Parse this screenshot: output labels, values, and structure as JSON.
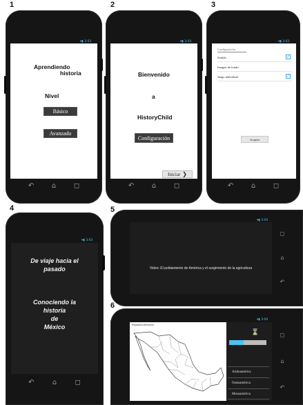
{
  "labels": [
    "1",
    "2",
    "3",
    "4",
    "5",
    "6"
  ],
  "status_time_a": "3:03",
  "status_time_b": "3:04",
  "nav_icons": [
    "back-icon",
    "home-icon",
    "recents-icon"
  ],
  "screen1": {
    "title_line1": "Aprendiendo",
    "title_line2": "historia",
    "level_label": "Nivel",
    "basic_button": "Básico",
    "advanced_button": "Avanzado"
  },
  "screen2": {
    "welcome": "Bienvenido",
    "to": "a",
    "app_name": "HistoryChild",
    "settings_button": "Configuración",
    "start_button": "Iniciar"
  },
  "screen3": {
    "header": "Configuración",
    "options": [
      {
        "label": "Sonido",
        "checked": true
      },
      {
        "label": "Imagen de fondo",
        "checked": false
      },
      {
        "label": "Juego individual",
        "checked": true
      }
    ],
    "accept_button": "Aceptar"
  },
  "screen4": {
    "line1": "De viaje hacia el",
    "line2": "pasado",
    "line3": "Conociendo la",
    "line4": "historia",
    "line5": "de",
    "line6": "México"
  },
  "screen5": {
    "video_caption": "Video: El poblamiento de América y el surgimiento de la agricultura"
  },
  "screen6": {
    "map_title": "Republica Mexicana",
    "list_items": [
      "Aridoamérica",
      "Oasisamérica",
      "Mesoamérica"
    ]
  },
  "colors": {
    "accent": "#4cc3f0",
    "checkbox": "#3aa6e0",
    "phone_body": "#151515"
  }
}
